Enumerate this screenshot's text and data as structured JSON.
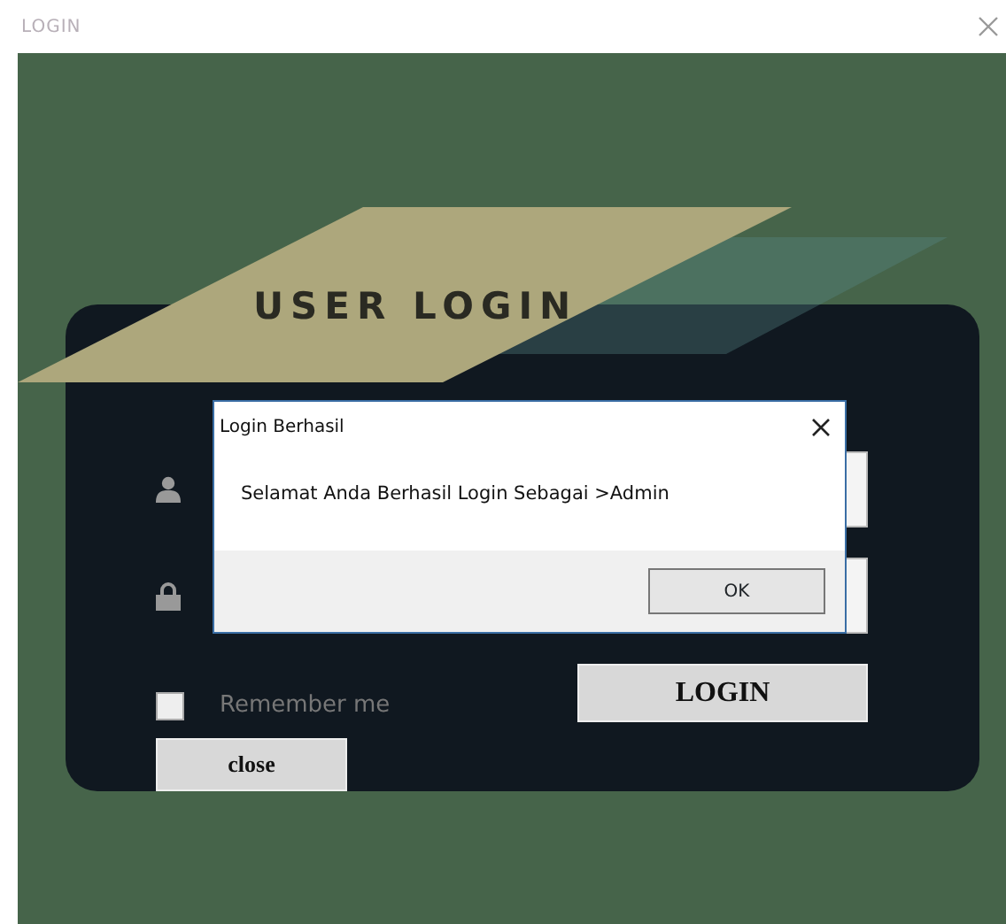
{
  "window": {
    "title": "LOGIN"
  },
  "heading": "USER LOGIN",
  "fields": [
    {
      "kind": "user"
    },
    {
      "kind": "lock"
    }
  ],
  "remember": {
    "label": "Remember me",
    "checked": false
  },
  "login_button": "LOGIN",
  "close_button": "close",
  "dialog": {
    "title": "Login Berhasil",
    "message": "Selamat Anda Berhasil Login Sebagai >Admin",
    "ok": "OK"
  }
}
